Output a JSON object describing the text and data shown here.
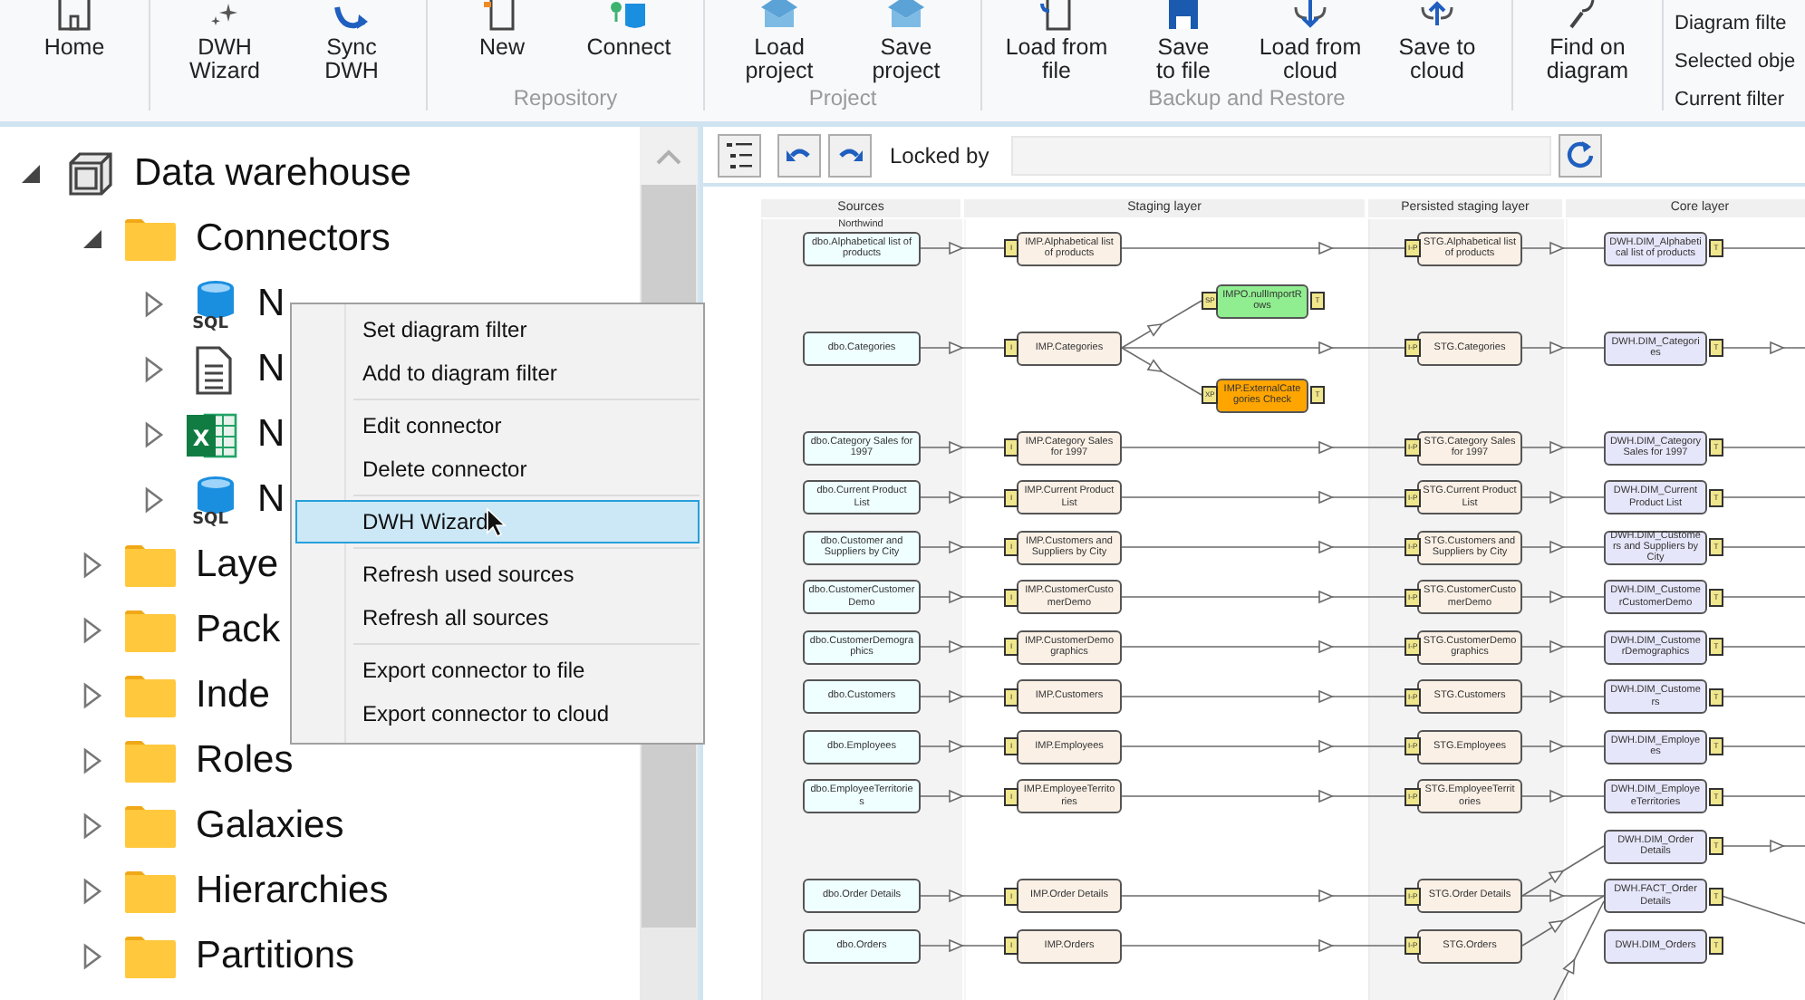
{
  "ribbon": {
    "groups": [
      {
        "buttons": [
          {
            "label": "Home"
          }
        ]
      },
      {
        "buttons": [
          {
            "label": "DWH\nWizard"
          },
          {
            "label": "Sync\nDWH"
          }
        ]
      },
      {
        "label": "Repository",
        "buttons": [
          {
            "label": "New"
          },
          {
            "label": "Connect"
          }
        ]
      },
      {
        "label": "Project",
        "buttons": [
          {
            "label": "Load\nproject"
          },
          {
            "label": "Save\nproject"
          }
        ]
      },
      {
        "label": "Backup and Restore",
        "buttons": [
          {
            "label": "Load from\nfile"
          },
          {
            "label": "Save\nto file"
          },
          {
            "label": "Load from\ncloud"
          },
          {
            "label": "Save to\ncloud"
          }
        ]
      },
      {
        "buttons": [
          {
            "label": "Find on\ndiagram"
          }
        ]
      }
    ],
    "filter_panel": [
      "Diagram filte",
      "Selected obje",
      "Current filter"
    ]
  },
  "tree": [
    {
      "label": "Data warehouse",
      "kind": "warehouse",
      "expanded": true,
      "children": [
        {
          "label": "Connectors",
          "kind": "folder",
          "expanded": true,
          "children": [
            {
              "label": "N",
              "kind": "sql",
              "icon_text": "SQL",
              "expanded": false
            },
            {
              "label": "N",
              "kind": "file",
              "expanded": false
            },
            {
              "label": "N",
              "kind": "excel",
              "icon_text": "X",
              "expanded": false
            },
            {
              "label": "N",
              "kind": "sql",
              "icon_text": "SQL",
              "expanded": false
            }
          ]
        },
        {
          "label": "Laye",
          "kind": "folder",
          "expanded": false
        },
        {
          "label": "Pack",
          "kind": "folder",
          "expanded": false
        },
        {
          "label": "Inde",
          "kind": "folder",
          "expanded": false
        },
        {
          "label": "Roles",
          "kind": "folder",
          "expanded": false
        },
        {
          "label": "Galaxies",
          "kind": "folder",
          "expanded": false
        },
        {
          "label": "Hierarchies",
          "kind": "folder",
          "expanded": false
        },
        {
          "label": "Partitions",
          "kind": "folder",
          "expanded": false
        }
      ]
    }
  ],
  "context_menu": [
    {
      "kind": "item",
      "label": "Set diagram filter",
      "selected": false
    },
    {
      "kind": "item",
      "label": "Add to diagram filter",
      "selected": false
    },
    {
      "kind": "separator"
    },
    {
      "kind": "item",
      "label": "Edit connector",
      "selected": false
    },
    {
      "kind": "item",
      "label": "Delete connector",
      "selected": false
    },
    {
      "kind": "separator"
    },
    {
      "kind": "item",
      "label": "DWH Wizard",
      "selected": true
    },
    {
      "kind": "separator"
    },
    {
      "kind": "item",
      "label": "Refresh used sources",
      "selected": false
    },
    {
      "kind": "item",
      "label": "Refresh all sources",
      "selected": false
    },
    {
      "kind": "separator"
    },
    {
      "kind": "item",
      "label": "Export connector to file",
      "selected": false
    },
    {
      "kind": "item",
      "label": "Export connector to cloud",
      "selected": false
    }
  ],
  "diagram_toolbar": {
    "locked_by_label": "Locked by"
  },
  "diagram": {
    "lanes": [
      {
        "title": "Sources",
        "subtitle": "Northwind",
        "shaded": true
      },
      {
        "title": "Staging layer",
        "shaded": false
      },
      {
        "title": "Persisted staging layer",
        "shaded": true
      },
      {
        "title": "Core layer",
        "shaded": false
      }
    ],
    "rows": [
      {
        "source": {
          "text": "dbo.Alphabetical list of products"
        },
        "staging": {
          "text": "IMP.Alphabetical list of products",
          "badge": "I"
        },
        "persisted": {
          "text": "STG.Alphabetical list of products",
          "badge": "I-P"
        },
        "core": {
          "text": "DWH.DIM_Alphabetical list of products",
          "badge": "T",
          "kind": "line"
        }
      },
      {
        "source": {
          "text": "dbo.Categories"
        },
        "staging": {
          "text": "IMP.Categories",
          "badge": "I",
          "branches": [
            {
              "text": "IMPO.nullImportRows",
              "badge": "SP",
              "badge_right": "T",
              "color": "#90ee90"
            },
            {
              "text": "IMP.ExternalCategories Check",
              "badge": "XP",
              "badge_right": "T",
              "color": "#ffa500"
            }
          ]
        },
        "persisted": {
          "text": "STG.Categories",
          "badge": "I-P"
        },
        "core": {
          "text": "DWH.DIM_Categories",
          "badge": "T",
          "kind": "arrow"
        }
      },
      {
        "source": {
          "text": "dbo.Category Sales for 1997"
        },
        "staging": {
          "text": "IMP.Category Sales for 1997",
          "badge": "I"
        },
        "persisted": {
          "text": "STG.Category Sales for 1997",
          "badge": "I-P"
        },
        "core": {
          "text": "DWH.DIM_Category Sales for 1997",
          "badge": "T",
          "kind": "line"
        }
      },
      {
        "source": {
          "text": "dbo.Current Product List"
        },
        "staging": {
          "text": "IMP.Current Product List",
          "badge": "I"
        },
        "persisted": {
          "text": "STG.Current Product List",
          "badge": "I-P"
        },
        "core": {
          "text": "DWH.DIM_Current Product List",
          "badge": "T",
          "kind": "line"
        }
      },
      {
        "source": {
          "text": "dbo.Customer and Suppliers by City"
        },
        "staging": {
          "text": "IMP.Customers and Suppliers by City",
          "badge": "I"
        },
        "persisted": {
          "text": "STG.Customers and Suppliers by City",
          "badge": "I-P"
        },
        "core": {
          "text": "DWH.DIM_Customers and Suppliers by City",
          "badge": "T",
          "kind": "line"
        }
      },
      {
        "source": {
          "text": "dbo.CustomerCustomerDemo"
        },
        "staging": {
          "text": "IMP.CustomerCustomerDemo",
          "badge": "I"
        },
        "persisted": {
          "text": "STG.CustomerCustomerDemo",
          "badge": "I-P"
        },
        "core": {
          "text": "DWH.DIM_CustomerCustomerDemo",
          "badge": "T",
          "kind": "line"
        }
      },
      {
        "source": {
          "text": "dbo.CustomerDemographics"
        },
        "staging": {
          "text": "IMP.CustomerDemographics",
          "badge": "I"
        },
        "persisted": {
          "text": "STG.CustomerDemographics",
          "badge": "I-P"
        },
        "core": {
          "text": "DWH.DIM_CustomerDemographics",
          "badge": "T",
          "kind": "line"
        }
      },
      {
        "source": {
          "text": "dbo.Customers"
        },
        "staging": {
          "text": "IMP.Customers",
          "badge": "I"
        },
        "persisted": {
          "text": "STG.Customers",
          "badge": "I-P"
        },
        "core": {
          "text": "DWH.DIM_Customers",
          "badge": "T",
          "kind": "line"
        }
      },
      {
        "source": {
          "text": "dbo.Employees"
        },
        "staging": {
          "text": "IMP.Employees",
          "badge": "I"
        },
        "persisted": {
          "text": "STG.Employees",
          "badge": "I-P"
        },
        "core": {
          "text": "DWH.DIM_Employees",
          "badge": "T",
          "kind": "line"
        }
      },
      {
        "source": {
          "text": "dbo.EmployeeTerritories"
        },
        "staging": {
          "text": "IMP.EmployeeTerritories",
          "badge": "I"
        },
        "persisted": {
          "text": "STG.EmployeeTerritories",
          "badge": "I-P"
        },
        "core": {
          "text": "DWH.DIM_EmployeeTerritories",
          "badge": "T",
          "kind": "line"
        }
      },
      {
        "core": {
          "text": "DWH.DIM_Order Details",
          "badge": "T",
          "kind": "arrow"
        }
      },
      {
        "source": {
          "text": "dbo.Order Details"
        },
        "staging": {
          "text": "IMP.Order Details",
          "badge": "I"
        },
        "persisted": {
          "text": "STG.Order Details",
          "badge": "I-P",
          "kind": "split-up"
        },
        "core": {
          "text": "DWH.FACT_Order Details",
          "badge": "T",
          "kind": "diagonal",
          "incoming_from_below": true
        }
      },
      {
        "source": {
          "text": "dbo.Orders"
        },
        "staging": {
          "text": "IMP.Orders",
          "badge": "I"
        },
        "persisted": {
          "text": "STG.Orders",
          "badge": "I-P",
          "kind": "merge-up"
        },
        "core": {
          "text": "DWH.DIM_Orders",
          "badge": "T"
        }
      }
    ]
  }
}
